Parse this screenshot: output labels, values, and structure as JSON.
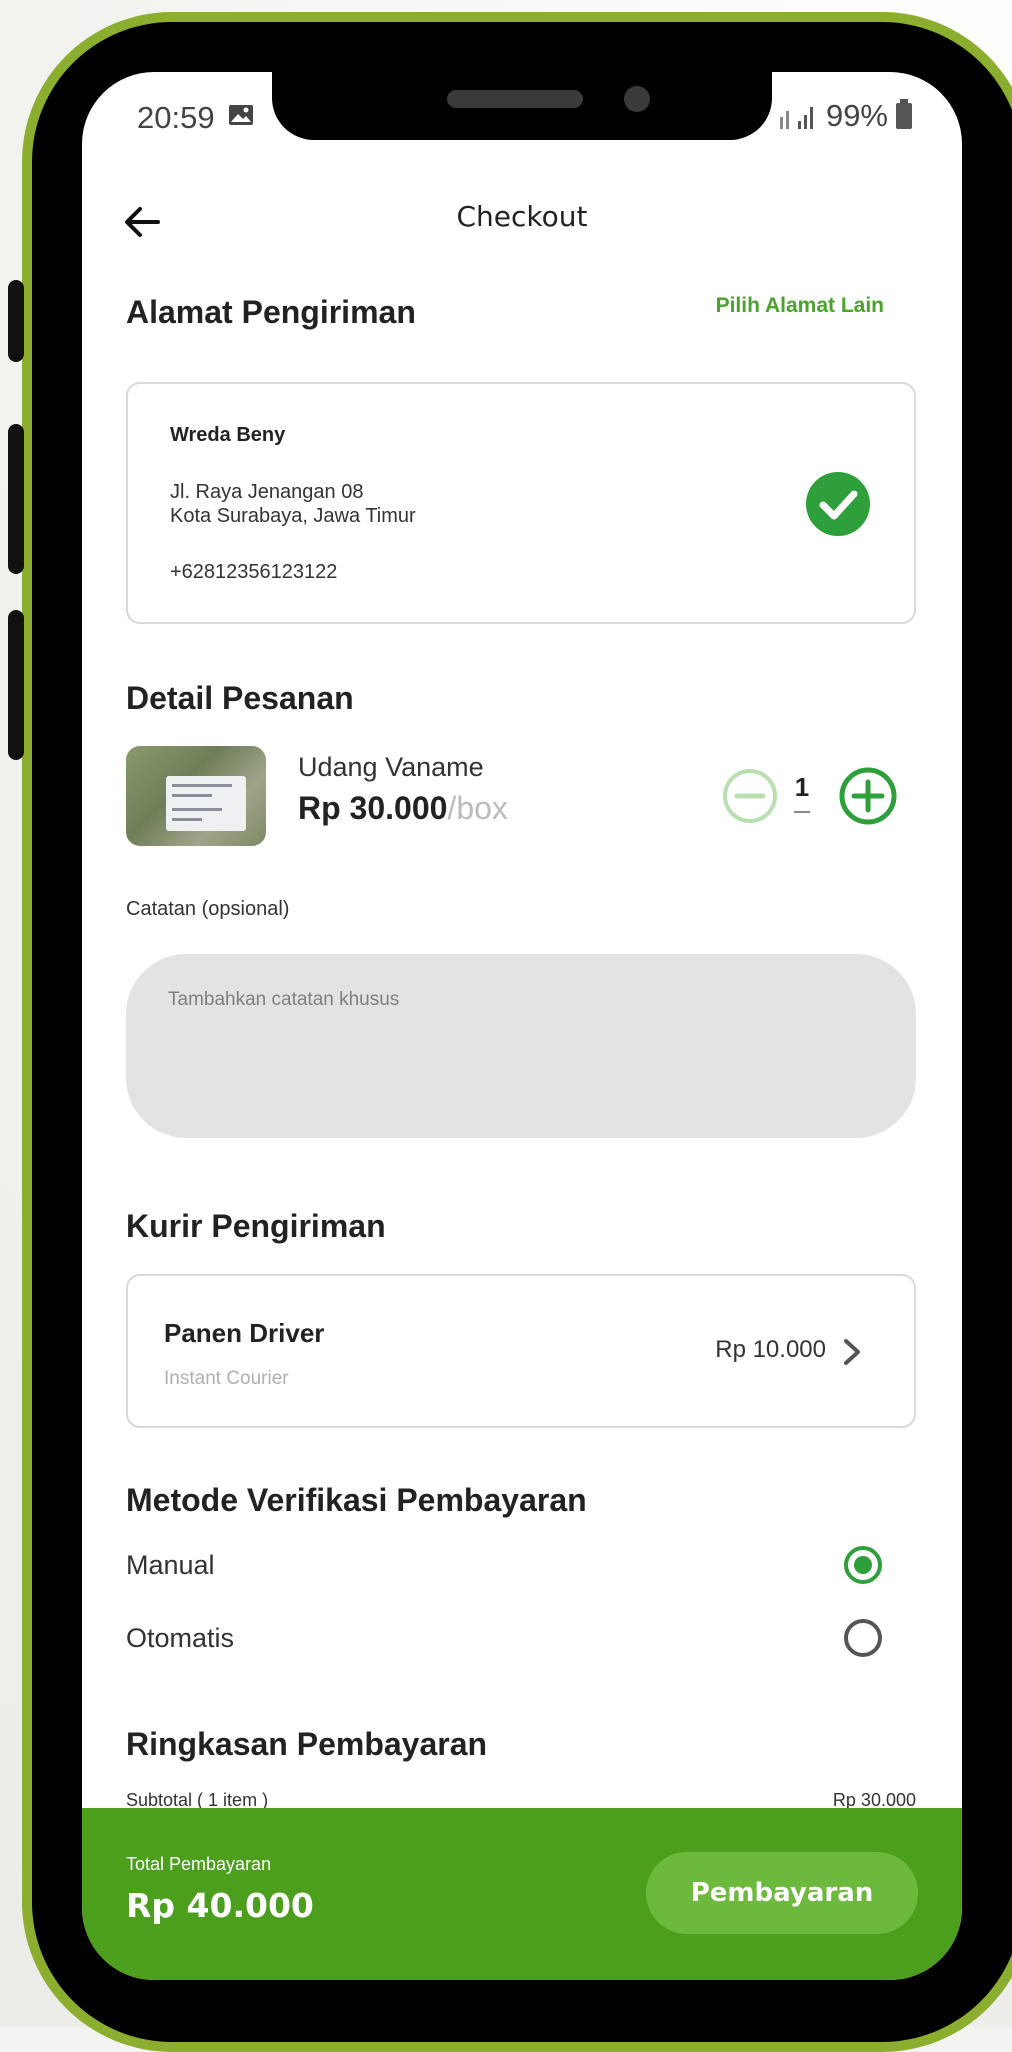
{
  "status_bar": {
    "time": "20:59",
    "battery": "99%"
  },
  "header": {
    "title": "Checkout"
  },
  "address": {
    "section_title": "Alamat Pengiriman",
    "change_link": "Pilih Alamat Lain",
    "name": "Wreda Beny",
    "line1": "Jl. Raya Jenangan 08",
    "line2": "Kota Surabaya, Jawa Timur",
    "phone": "+62812356123122"
  },
  "order": {
    "section_title": "Detail Pesanan",
    "product_name": "Udang Vaname",
    "price": "Rp 30.000",
    "unit": "/box",
    "quantity": "1"
  },
  "note": {
    "label": "Catatan (opsional)",
    "placeholder": "Tambahkan catatan khusus"
  },
  "courier": {
    "section_title": "Kurir Pengiriman",
    "name": "Panen Driver",
    "type": "Instant Courier",
    "price": "Rp 10.000"
  },
  "verification": {
    "section_title": "Metode Verifikasi Pembayaran",
    "options": [
      {
        "label": "Manual",
        "selected": true
      },
      {
        "label": "Otomatis",
        "selected": false
      }
    ]
  },
  "summary": {
    "section_title": "Ringkasan Pembayaran",
    "subtotal_label": "Subtotal ( 1 item )",
    "subtotal_value": "Rp 30.000"
  },
  "footer": {
    "total_label": "Total Pembayaran",
    "total_value": "Rp 40.000",
    "pay_button": "Pembayaran"
  },
  "colors": {
    "accent": "#4c9f1d",
    "frame": "#8cae2f",
    "check": "#2e9f3a"
  }
}
